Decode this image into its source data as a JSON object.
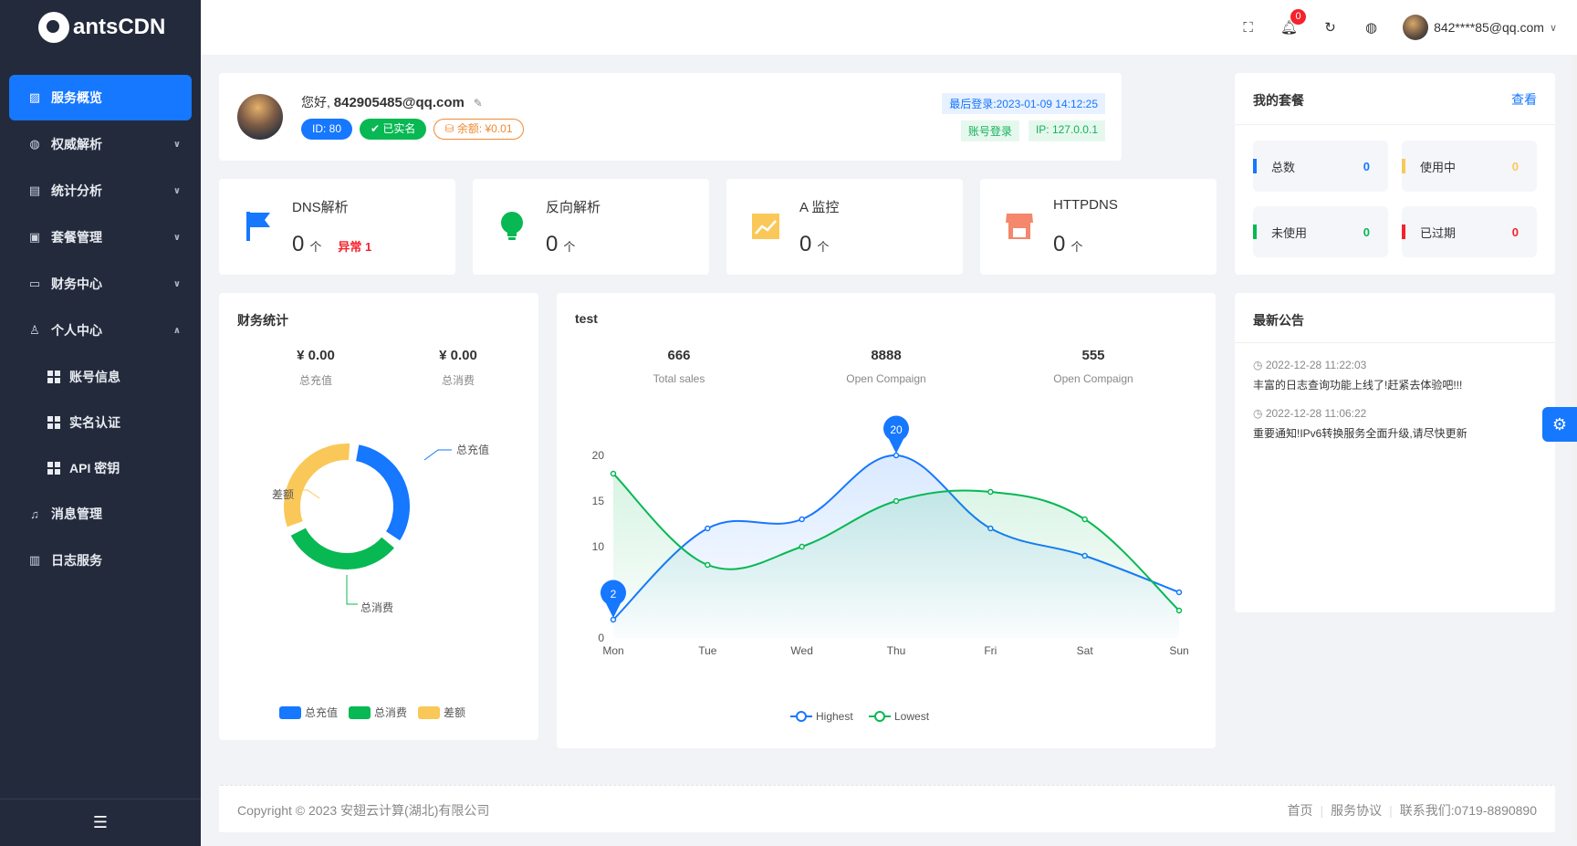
{
  "brand": {
    "name": "antsCDN"
  },
  "sidebar": {
    "items": [
      {
        "label": "服务概览",
        "icon": "chart-icon",
        "active": true
      },
      {
        "label": "权威解析",
        "icon": "globe-icon",
        "chevron": "down"
      },
      {
        "label": "统计分析",
        "icon": "document-icon",
        "chevron": "down"
      },
      {
        "label": "套餐管理",
        "icon": "gift-icon",
        "chevron": "down"
      },
      {
        "label": "财务中心",
        "icon": "card-icon",
        "chevron": "down"
      },
      {
        "label": "个人中心",
        "icon": "user-icon",
        "chevron": "up"
      },
      {
        "label": "消息管理",
        "icon": "bell-icon"
      },
      {
        "label": "日志服务",
        "icon": "log-icon"
      }
    ],
    "sub_items": [
      {
        "label": "账号信息"
      },
      {
        "label": "实名认证"
      },
      {
        "label": "API 密钥"
      }
    ]
  },
  "header": {
    "notification_count": "0",
    "user_email": "842****85@qq.com"
  },
  "welcome": {
    "greeting": "您好,",
    "email": "842905485@qq.com",
    "id_tag": "ID: 80",
    "verified_tag": "已实名",
    "balance_tag": "余额: ¥0.01",
    "last_login": "最后登录:2023-01-09 14:12:25",
    "login_method": "账号登录",
    "ip": "IP: 127.0.0.1"
  },
  "stats": [
    {
      "title": "DNS解析",
      "value": "0",
      "unit": "个",
      "abnormal": "异常 1",
      "icon": "flag-icon"
    },
    {
      "title": "反向解析",
      "value": "0",
      "unit": "个",
      "icon": "bulb-icon"
    },
    {
      "title": "A 监控",
      "value": "0",
      "unit": "个",
      "icon": "trend-icon"
    },
    {
      "title": "HTTPDNS",
      "value": "0",
      "unit": "个",
      "icon": "store-icon"
    }
  ],
  "package": {
    "title": "我的套餐",
    "link": "查看",
    "cells": [
      {
        "label": "总数",
        "value": "0",
        "color": "#1677ff"
      },
      {
        "label": "使用中",
        "value": "0",
        "color": "#fac858"
      },
      {
        "label": "未使用",
        "value": "0",
        "color": "#07b853"
      },
      {
        "label": "已过期",
        "value": "0",
        "color": "#f5222d"
      }
    ]
  },
  "finance": {
    "title": "财务统计",
    "recharge_total": "¥ 0.00",
    "recharge_label": "总充值",
    "consume_total": "¥ 0.00",
    "consume_label": "总消费"
  },
  "test": {
    "title": "test",
    "kpis": [
      {
        "value": "666",
        "label": "Total sales"
      },
      {
        "value": "8888",
        "label": "Open Compaign"
      },
      {
        "value": "555",
        "label": "Open Compaign"
      }
    ]
  },
  "notice": {
    "title": "最新公告",
    "items": [
      {
        "time": "2022-12-28 11:22:03",
        "text": "丰富的日志查询功能上线了!赶紧去体验吧!!!"
      },
      {
        "time": "2022-12-28 11:06:22",
        "text": "重要通知!IPv6转换服务全面升级,请尽快更新"
      }
    ]
  },
  "footer": {
    "copyright": "Copyright © 2023 安翅云计算(湖北)有限公司",
    "links": [
      "首页",
      "服务协议",
      "联系我们:0719-8890890"
    ]
  },
  "chart_data": [
    {
      "type": "pie",
      "categories": [
        "总充值",
        "总消费",
        "差额"
      ],
      "values": [
        1,
        1,
        1
      ],
      "legend_position": "bottom",
      "colors": [
        "#1677ff",
        "#07b853",
        "#fac858"
      ]
    },
    {
      "type": "line",
      "categories": [
        "Mon",
        "Tue",
        "Wed",
        "Thu",
        "Fri",
        "Sat",
        "Sun"
      ],
      "series": [
        {
          "name": "Highest",
          "values": [
            2,
            12,
            13,
            20,
            12,
            9,
            5
          ],
          "color": "#1677ff"
        },
        {
          "name": "Lowest",
          "values": [
            18,
            8,
            10,
            15,
            16,
            13,
            3
          ],
          "color": "#07b853"
        }
      ],
      "ylim": [
        0,
        20
      ],
      "yticks": [
        0,
        10,
        15,
        20
      ],
      "annotations": [
        {
          "x": "Thu",
          "series": "Highest",
          "label": "20"
        },
        {
          "x": "Mon",
          "series": "Highest",
          "label": "2"
        }
      ],
      "legend_position": "bottom",
      "grid": false
    }
  ]
}
